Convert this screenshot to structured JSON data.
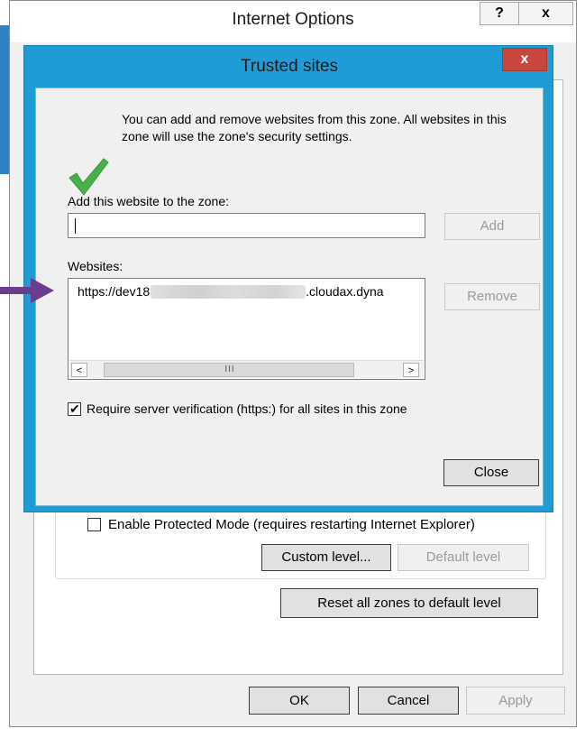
{
  "colors": {
    "dialog_frame": "#1f9cd6",
    "close_red": "#c9463d",
    "annotation_arrow": "#6a3d8e",
    "check_green": "#47b04b"
  },
  "internet_options": {
    "title": "Internet Options",
    "help_label": "?",
    "close_label": "x",
    "protected_mode_label": "Enable Protected Mode (requires restarting Internet Explorer)",
    "protected_mode_checked": false,
    "custom_level_label": "Custom level...",
    "default_level_label": "Default level",
    "reset_zones_label": "Reset all zones to default level",
    "ok_label": "OK",
    "cancel_label": "Cancel",
    "apply_label": "Apply"
  },
  "trusted_sites": {
    "title": "Trusted sites",
    "close_label": "x",
    "info_text": "You can add and remove websites from this zone. All websites in this zone will use the zone's security settings.",
    "add_label": "Add this website to the zone:",
    "add_input_value": "",
    "add_button": "Add",
    "websites_label": "Websites:",
    "website_prefix": "https://dev18",
    "website_suffix": ".cloudax.dyna",
    "remove_button": "Remove",
    "scroll_left": "<",
    "scroll_grip": "III",
    "scroll_right": ">",
    "require_https_label": "Require server verification (https:) for all sites in this zone",
    "require_https_checked": true,
    "check_glyph": "✔",
    "close_button": "Close"
  }
}
